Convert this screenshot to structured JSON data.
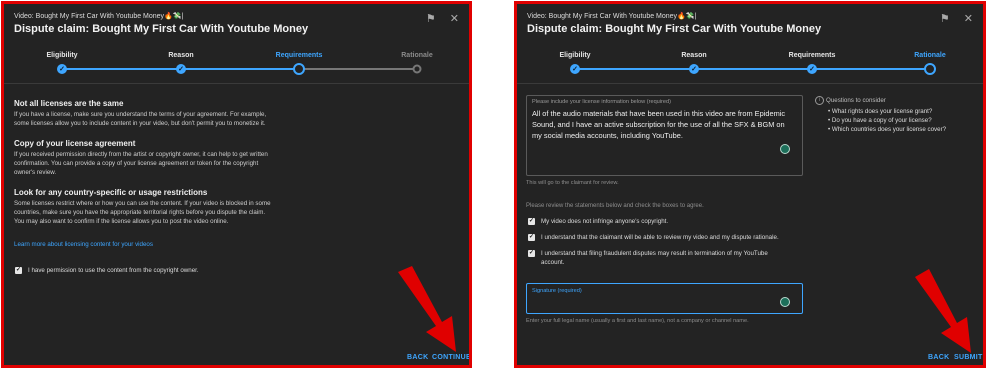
{
  "panel_left": {
    "video_line": "Video: Bought My First Car With Youtube Money🔥💸|",
    "title": "Dispute claim: Bought My First Car With Youtube Money",
    "steps": [
      {
        "label": "Eligibility",
        "state": "done"
      },
      {
        "label": "Reason",
        "state": "done"
      },
      {
        "label": "Requirements",
        "state": "current"
      },
      {
        "label": "Rationale",
        "state": "todo"
      }
    ],
    "sections": [
      {
        "heading": "Not all licenses are the same",
        "lines": [
          "If you have a license, make sure you understand the terms of your agreement. For example,",
          "some licenses allow you to include content in your video, but don't permit you to monetize it."
        ]
      },
      {
        "heading": "Copy of your license agreement",
        "lines": [
          "If you received permission directly from the artist or copyright owner, it can help to get written",
          "confirmation. You can provide a copy of your license agreement or token for the copyright",
          "owner's review."
        ]
      },
      {
        "heading": "Look for any country-specific or usage restrictions",
        "lines": [
          "Some licenses restrict where or how you can use the content. If your video is blocked in some",
          "countries, make sure you have the appropriate territorial rights before you dispute the claim.",
          "You may also want to confirm if the license allows you to post the video online."
        ]
      }
    ],
    "learn_more": "Learn more about licensing content for your videos",
    "permission_checkbox": "I have permission to use the content from the copyright owner.",
    "back": "BACK",
    "continue": "CONTINUE"
  },
  "panel_right": {
    "video_line": "Video: Bought My First Car With Youtube Money🔥💸|",
    "title": "Dispute claim: Bought My First Car With Youtube Money",
    "steps": [
      {
        "label": "Eligibility",
        "state": "done"
      },
      {
        "label": "Reason",
        "state": "done"
      },
      {
        "label": "Requirements",
        "state": "done"
      },
      {
        "label": "Rationale",
        "state": "current"
      }
    ],
    "license_box": {
      "label": "Please include your license information below (required)",
      "lines": [
        "All of the audio materials that have been used in this video are from Epidemic",
        "Sound, and I have an active subscription for the use of all the SFX & BGM on",
        "my social media accounts, including YouTube."
      ],
      "helper": "This will go to the claimant for review."
    },
    "questions": {
      "title": "Questions to consider",
      "items": [
        "What rights does your license grant?",
        "Do you have a copy of your license?",
        "Which countries does your license cover?"
      ]
    },
    "review_text": "Please review the statements below and check the boxes to agree.",
    "statements": [
      "My video does not infringe anyone's copyright.",
      "I understand that the claimant will be able to review my video and my dispute rationale.",
      "I understand that filing fraudulent disputes may result in termination of my YouTube",
      "account."
    ],
    "signature": {
      "label": "Signature (required)",
      "helper": "Enter your full legal name (usually a first and last name), not a company or channel name."
    },
    "back": "BACK",
    "submit": "SUBMIT"
  },
  "colors": {
    "accent": "#3ea6ff",
    "panel_bg": "#232323",
    "frame": "#e00000",
    "arrow": "#e00000"
  }
}
